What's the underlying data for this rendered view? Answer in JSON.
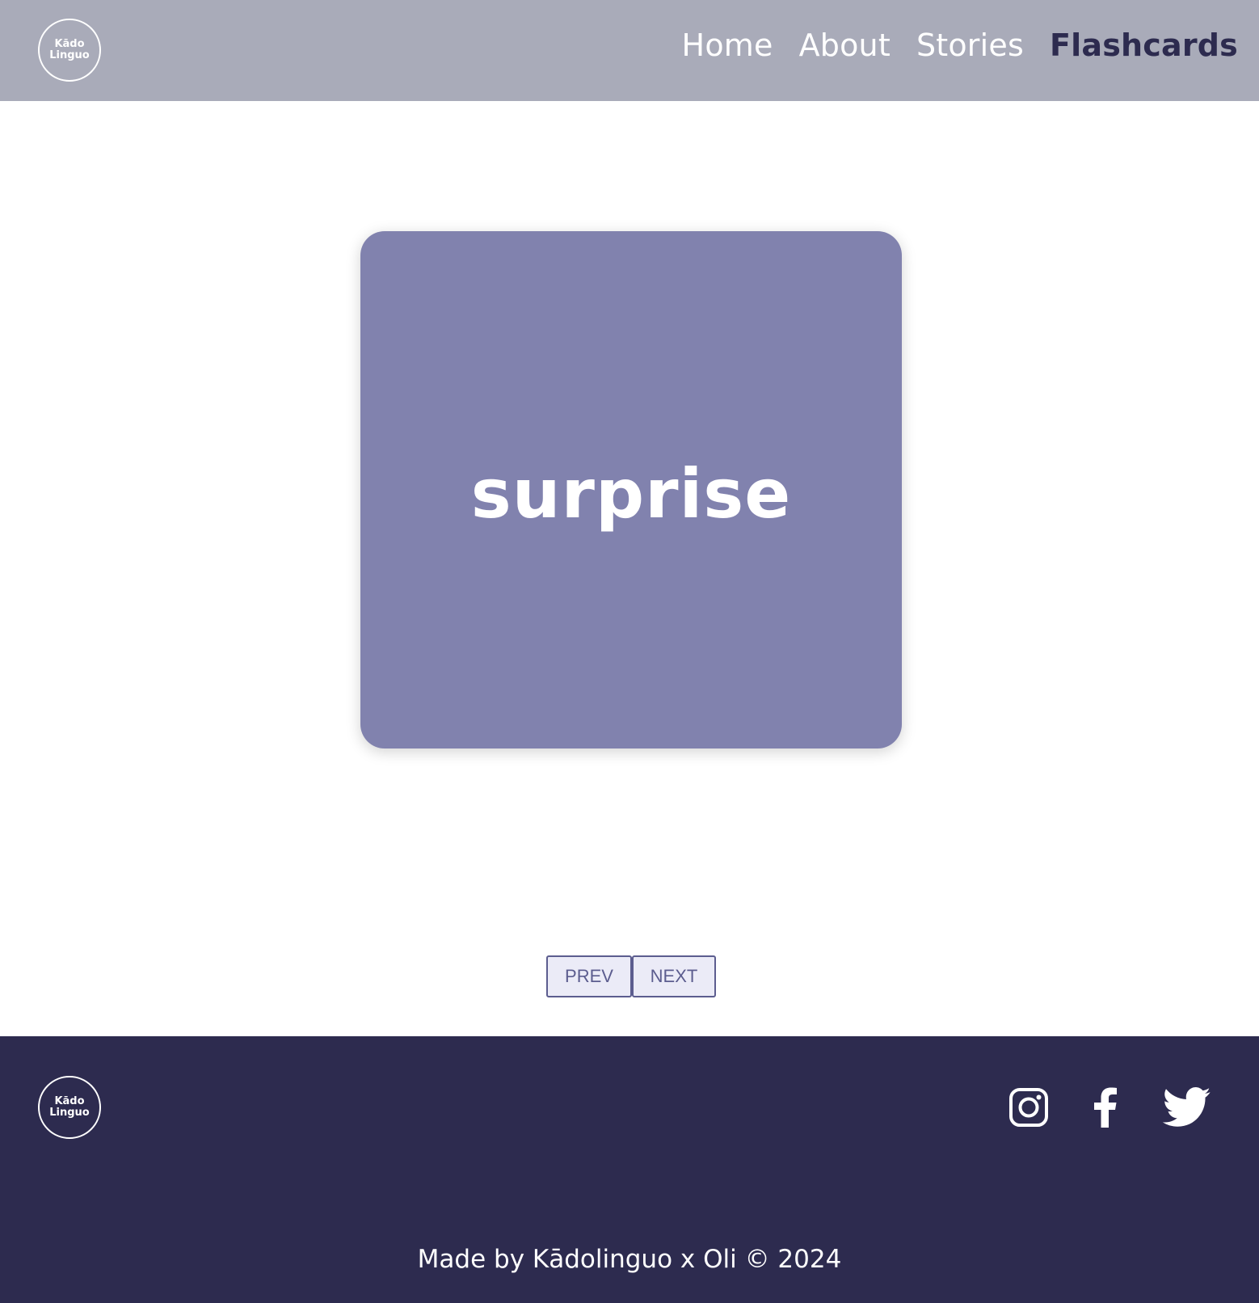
{
  "header": {
    "logo": {
      "line1": "Kādo",
      "line2": "Linguo"
    },
    "nav": [
      {
        "label": "Home",
        "active": false
      },
      {
        "label": "About",
        "active": false
      },
      {
        "label": "Stories",
        "active": false
      },
      {
        "label": "Flashcards",
        "active": true
      }
    ]
  },
  "card": {
    "word": "surprise"
  },
  "controls": {
    "prev_label": "PREV",
    "next_label": "NEXT"
  },
  "footer": {
    "logo": {
      "line1": "Kādo",
      "line2": "Linguo"
    },
    "social": [
      {
        "icon": "instagram-icon"
      },
      {
        "icon": "facebook-icon"
      },
      {
        "icon": "twitter-icon"
      }
    ],
    "copyright": "Made by Kādolinguo x Oli © 2024"
  },
  "colors": {
    "header_bg": "#a9abb9",
    "nav_active": "#2d2b4f",
    "card_bg": "#8182ae",
    "button_bg": "#ebebf7",
    "button_border": "#5c5d8f",
    "footer_bg": "#2d2b4f"
  }
}
